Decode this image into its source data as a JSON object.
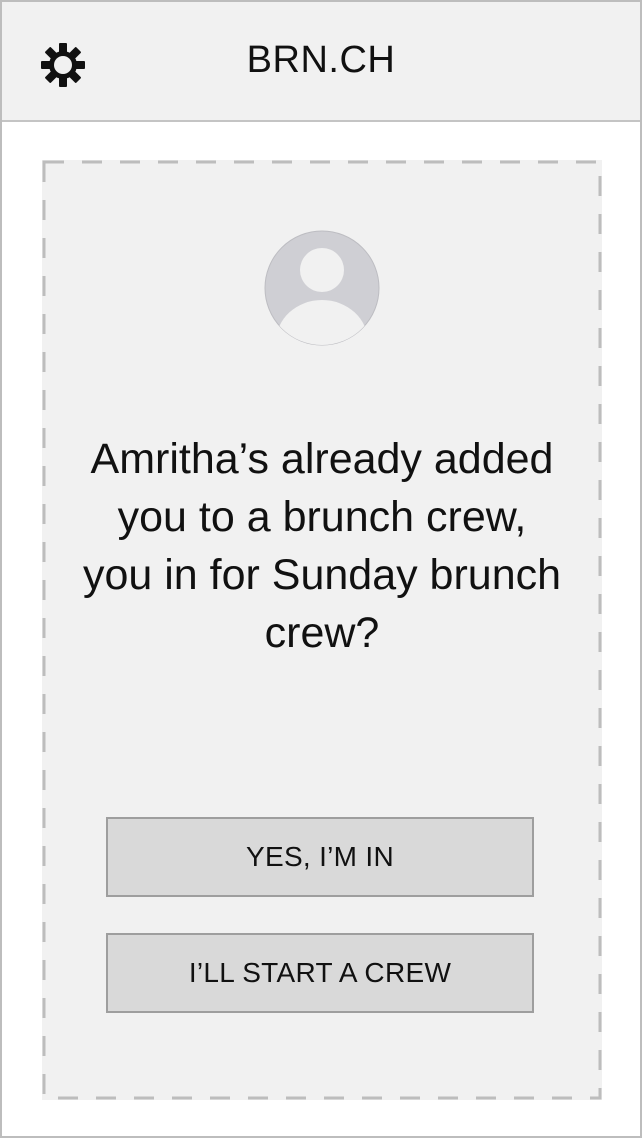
{
  "header": {
    "title": "BRN.CH",
    "settings_icon": "gear-icon"
  },
  "invite": {
    "avatar_icon": "user-avatar-placeholder-icon",
    "message": "Amritha’s already added you to a brunch crew, you in for Sunday brunch crew?"
  },
  "actions": {
    "yes_label": "YES, I’M IN",
    "start_label": "I’LL START A CREW"
  },
  "colors": {
    "header_bg": "#f1f1f1",
    "card_bg": "#f1f1f1",
    "button_bg": "#d9d9d9",
    "button_border": "#9e9e9e",
    "avatar_bg": "#cfcfd4",
    "text": "#111111"
  }
}
